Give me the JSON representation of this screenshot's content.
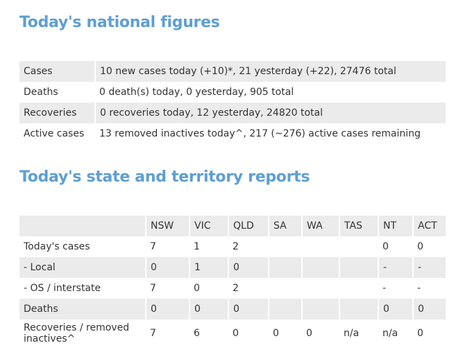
{
  "national": {
    "title": "Today's national figures",
    "rows": [
      {
        "label": "Cases",
        "value": "10 new cases today (+10)*, 21 yesterday (+22), 27476 total"
      },
      {
        "label": "Deaths",
        "value": "0 death(s) today, 0 yesterday, 905 total"
      },
      {
        "label": "Recoveries",
        "value": "0 recoveries today, 12 yesterday, 24820 total"
      },
      {
        "label": "Active cases",
        "value": "13 removed inactives today^, 217 (~276) active cases remaining"
      }
    ]
  },
  "states": {
    "title": "Today's state and territory reports",
    "columns": [
      "",
      "NSW",
      "VIC",
      "QLD",
      "SA",
      "WA",
      "TAS",
      "NT",
      "ACT"
    ],
    "rows": [
      {
        "label": "Today's cases",
        "values": [
          "7",
          "1",
          "2",
          "",
          "",
          "",
          "0",
          "0"
        ]
      },
      {
        "label": "- Local",
        "values": [
          "0",
          "1",
          "0",
          "",
          "",
          "",
          "-",
          "-"
        ]
      },
      {
        "label": "- OS / interstate",
        "values": [
          "7",
          "0",
          "2",
          "",
          "",
          "",
          "-",
          "-"
        ]
      },
      {
        "label": "Deaths",
        "values": [
          "0",
          "0",
          "0",
          "",
          "",
          "",
          "0",
          "0"
        ]
      },
      {
        "label": "Recoveries / removed inactives^",
        "values": [
          "7",
          "6",
          "0",
          "0",
          "0",
          "n/a",
          "n/a",
          "0"
        ]
      }
    ]
  },
  "colors": {
    "heading": "#5d9fd3",
    "row_shade": "#ebebeb",
    "text": "#333333"
  }
}
